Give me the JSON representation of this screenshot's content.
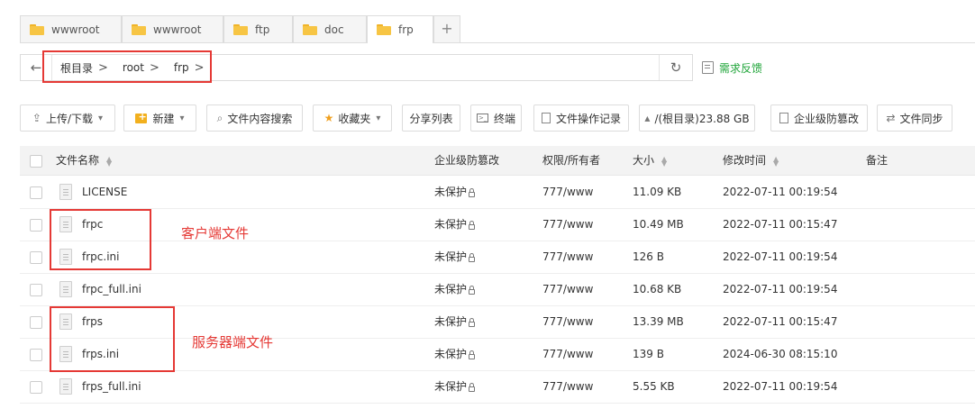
{
  "tabs": [
    {
      "label": "wwwroot",
      "active": false
    },
    {
      "label": "wwwroot",
      "active": false
    },
    {
      "label": "ftp",
      "active": false
    },
    {
      "label": "doc",
      "active": false
    },
    {
      "label": "frp",
      "active": true
    }
  ],
  "tab_add": "+",
  "path": {
    "back_icon": "←",
    "segments": [
      "根目录",
      "root",
      "frp"
    ],
    "separator": ">",
    "refresh_icon": "↻"
  },
  "feedback_label": "需求反馈",
  "toolbar": {
    "upload_label": "上传/下载",
    "new_label": "新建",
    "search_content_label": "文件内容搜索",
    "favorites_label": "收藏夹",
    "share_list_label": "分享列表",
    "terminal_label": "终端",
    "file_log_label": "文件操作记录",
    "disk_label": "/(根目录)23.88 GB",
    "tamper_label": "企业级防篡改",
    "file_sync_label": "文件同步"
  },
  "table": {
    "headers": {
      "name": "文件名称",
      "protect": "企业级防篡改",
      "perm": "权限/所有者",
      "size": "大小",
      "mtime": "修改时间",
      "note": "备注"
    },
    "rows": [
      {
        "name": "LICENSE",
        "protect": "未保护",
        "perm": "777/www",
        "size": "11.09 KB",
        "mtime": "2022-07-11 00:19:54",
        "note": ""
      },
      {
        "name": "frpc",
        "protect": "未保护",
        "perm": "777/www",
        "size": "10.49 MB",
        "mtime": "2022-07-11 00:15:47",
        "note": ""
      },
      {
        "name": "frpc.ini",
        "protect": "未保护",
        "perm": "777/www",
        "size": "126 B",
        "mtime": "2022-07-11 00:19:54",
        "note": ""
      },
      {
        "name": "frpc_full.ini",
        "protect": "未保护",
        "perm": "777/www",
        "size": "10.68 KB",
        "mtime": "2022-07-11 00:19:54",
        "note": ""
      },
      {
        "name": "frps",
        "protect": "未保护",
        "perm": "777/www",
        "size": "13.39 MB",
        "mtime": "2022-07-11 00:15:47",
        "note": ""
      },
      {
        "name": "frps.ini",
        "protect": "未保护",
        "perm": "777/www",
        "size": "139 B",
        "mtime": "2024-06-30 08:15:10",
        "note": ""
      },
      {
        "name": "frps_full.ini",
        "protect": "未保护",
        "perm": "777/www",
        "size": "5.55 KB",
        "mtime": "2022-07-11 00:19:54",
        "note": ""
      }
    ]
  },
  "annotations": {
    "client_files": "客户端文件",
    "server_files": "服务器端文件"
  },
  "colors": {
    "accent_green": "#20a53a",
    "annotation_red": "#e53935",
    "folder_yellow": "#f7c544"
  }
}
